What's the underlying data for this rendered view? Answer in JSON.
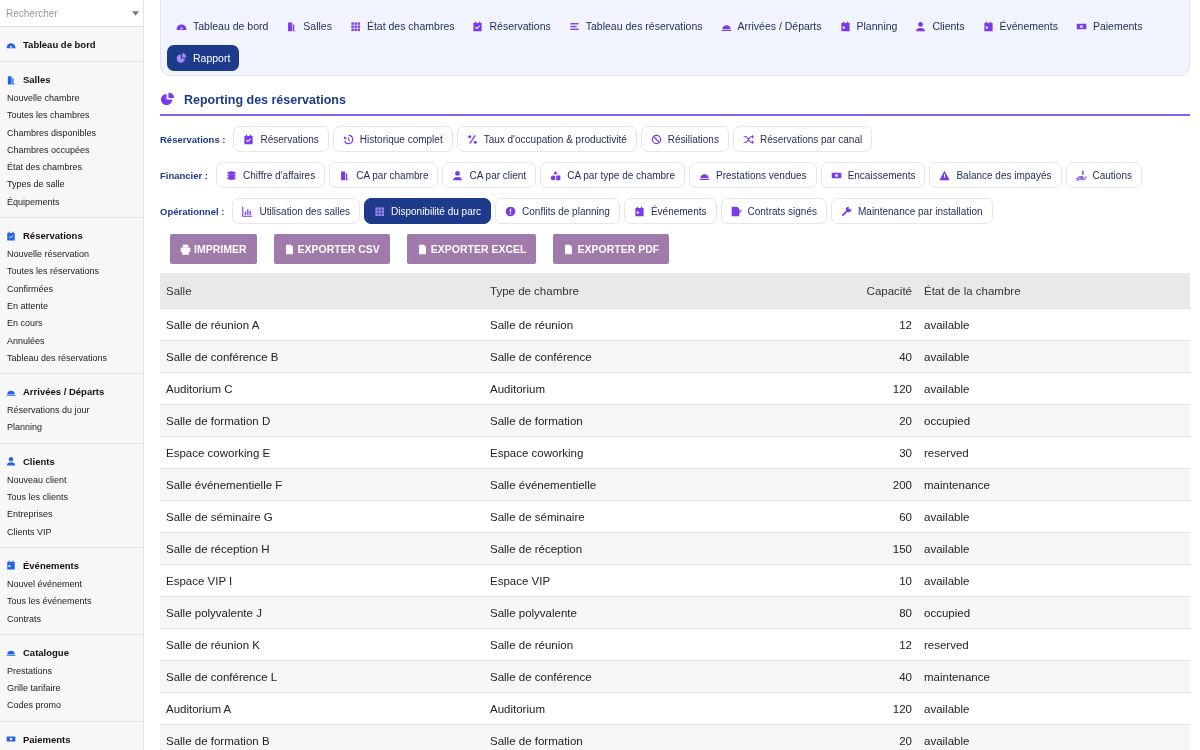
{
  "sidebar": {
    "search": {
      "placeholder": "Rechercher"
    },
    "sections": [
      {
        "title": "Tableau de bord"
      },
      {
        "title": "Salles",
        "items": [
          "Nouvelle chambre",
          "Toutes les chambres",
          "Chambres disponibles",
          "Chambres occupées",
          "État des chambres",
          "Types de salle",
          "Équipements"
        ]
      },
      {
        "title": "Réservations",
        "items": [
          "Nouvelle réservation",
          "Toutes les réservations",
          "Confirmées",
          "En attente",
          "En cours",
          "Annulées",
          "Tableau des réservations"
        ]
      },
      {
        "title": "Arrivées / Départs",
        "items": [
          "Réservations du jour",
          "Planning"
        ]
      },
      {
        "title": "Clients",
        "items": [
          "Nouveau client",
          "Tous les clients",
          "Entreprises",
          "Clients VIP"
        ]
      },
      {
        "title": "Événements",
        "items": [
          "Nouvel événement",
          "Tous les événements",
          "Contrats"
        ]
      },
      {
        "title": "Catalogue",
        "items": [
          "Prestations",
          "Grille tarifaire",
          "Codes promo"
        ]
      },
      {
        "title": "Paiements"
      }
    ]
  },
  "nav": [
    {
      "label": "Tableau de bord",
      "selected": false
    },
    {
      "label": "Salles",
      "selected": false
    },
    {
      "label": "État des chambres",
      "selected": false
    },
    {
      "label": "Réservations",
      "selected": false
    },
    {
      "label": "Tableau des réservations",
      "selected": false
    },
    {
      "label": "Arrivées / Départs",
      "selected": false
    },
    {
      "label": "Planning",
      "selected": false
    },
    {
      "label": "Clients",
      "selected": false
    },
    {
      "label": "Événements",
      "selected": false
    },
    {
      "label": "Paiements",
      "selected": false
    },
    {
      "label": "Rapport",
      "selected": true
    }
  ],
  "page_title": "Reporting des réservations",
  "filter_groups": [
    {
      "label": "Réservations :",
      "chips": [
        {
          "label": "Réservations",
          "selected": false
        },
        {
          "label": "Historique complet",
          "selected": false
        },
        {
          "label": "Taux d'occupation & productivité",
          "selected": false
        },
        {
          "label": "Résiliations",
          "selected": false
        },
        {
          "label": "Réservations par canal",
          "selected": false
        }
      ]
    },
    {
      "label": "Financier :",
      "chips": [
        {
          "label": "Chiffre d'affaires",
          "selected": false
        },
        {
          "label": "CA par chambre",
          "selected": false
        },
        {
          "label": "CA par client",
          "selected": false
        },
        {
          "label": "CA par type de chambre",
          "selected": false
        },
        {
          "label": "Prestations vendues",
          "selected": false
        },
        {
          "label": "Encaissements",
          "selected": false
        },
        {
          "label": "Balance des impayés",
          "selected": false
        },
        {
          "label": "Cautions",
          "selected": false
        }
      ]
    },
    {
      "label": "Opérationnel :",
      "chips": [
        {
          "label": "Utilisation des salles",
          "selected": false
        },
        {
          "label": "Disponibilité du parc",
          "selected": true
        },
        {
          "label": "Conflits de planning",
          "selected": false
        },
        {
          "label": "Événements",
          "selected": false
        },
        {
          "label": "Contrats signés",
          "selected": false
        },
        {
          "label": "Maintenance par installation",
          "selected": false
        }
      ]
    }
  ],
  "export_buttons": [
    "IMPRIMER",
    "EXPORTER CSV",
    "EXPORTER EXCEL",
    "EXPORTER PDF"
  ],
  "table": {
    "columns": [
      "Salle",
      "Type de chambre",
      "Capacité",
      "État de la chambre"
    ],
    "rows": [
      [
        "Salle de réunion A",
        "Salle de réunion",
        "12",
        "available"
      ],
      [
        "Salle de conférence B",
        "Salle de conférence",
        "40",
        "available"
      ],
      [
        "Auditorium C",
        "Auditorium",
        "120",
        "available"
      ],
      [
        "Salle de formation D",
        "Salle de formation",
        "20",
        "occupied"
      ],
      [
        "Espace coworking E",
        "Espace coworking",
        "30",
        "reserved"
      ],
      [
        "Salle événementielle F",
        "Salle événementielle",
        "200",
        "maintenance"
      ],
      [
        "Salle de séminaire G",
        "Salle de séminaire",
        "60",
        "available"
      ],
      [
        "Salle de réception H",
        "Salle de réception",
        "150",
        "available"
      ],
      [
        "Espace VIP I",
        "Espace VIP",
        "10",
        "available"
      ],
      [
        "Salle polyvalente J",
        "Salle polyvalente",
        "80",
        "occupied"
      ],
      [
        "Salle de réunion K",
        "Salle de réunion",
        "12",
        "reserved"
      ],
      [
        "Salle de conférence L",
        "Salle de conférence",
        "40",
        "maintenance"
      ],
      [
        "Auditorium A",
        "Auditorium",
        "120",
        "available"
      ],
      [
        "Salle de formation B",
        "Salle de formation",
        "20",
        "available"
      ]
    ]
  }
}
